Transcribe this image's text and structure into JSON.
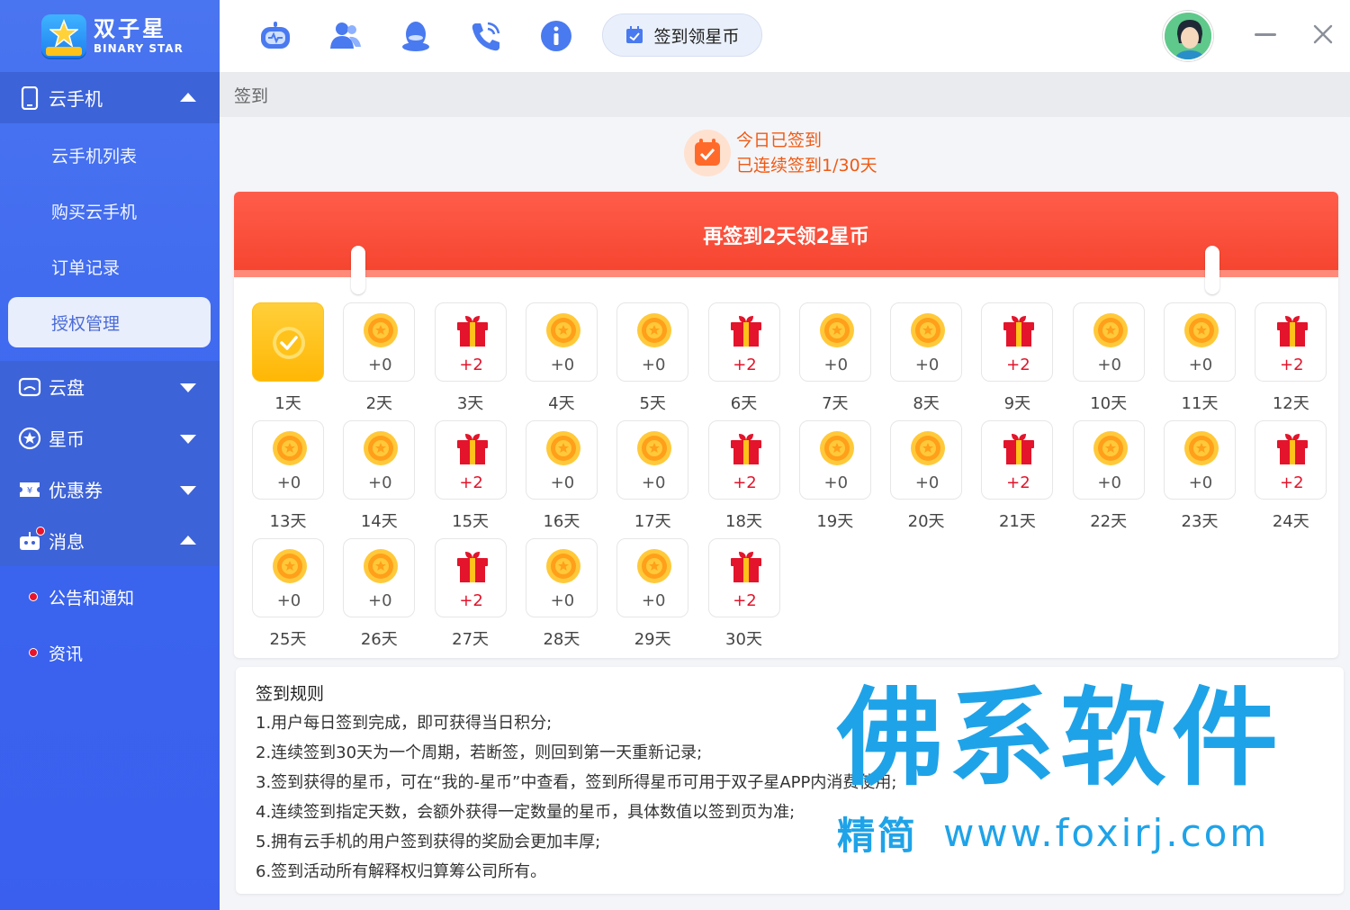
{
  "brand": {
    "name_cn": "双子星",
    "name_en": "BINARY STAR",
    "tag": "双子星"
  },
  "sidebar": {
    "cloud_phone": {
      "label": "云手机",
      "expanded": true,
      "items": [
        "云手机列表",
        "购买云手机",
        "订单记录",
        "授权管理"
      ],
      "active": "授权管理"
    },
    "cloud_disk": {
      "label": "云盘",
      "expanded": false
    },
    "star_coin": {
      "label": "星币",
      "expanded": false
    },
    "coupon": {
      "label": "优惠券",
      "expanded": false
    },
    "messages": {
      "label": "消息",
      "expanded": true,
      "items": [
        "公告和通知",
        "资讯"
      ]
    }
  },
  "topbar": {
    "icons": [
      "robot-icon",
      "users-icon",
      "qq-penguin-icon",
      "phone-icon",
      "info-icon"
    ],
    "checkin_button": "签到领星币"
  },
  "breadcrumb": "签到",
  "today": {
    "status": "今日已签到",
    "streak": "已连续签到1/30天"
  },
  "banner": "再签到2天领2星币",
  "days": [
    {
      "label": "1天",
      "type": "done",
      "pts": ""
    },
    {
      "label": "2天",
      "type": "coin",
      "pts": "+0"
    },
    {
      "label": "3天",
      "type": "gift",
      "pts": "+2"
    },
    {
      "label": "4天",
      "type": "coin",
      "pts": "+0"
    },
    {
      "label": "5天",
      "type": "coin",
      "pts": "+0"
    },
    {
      "label": "6天",
      "type": "gift",
      "pts": "+2"
    },
    {
      "label": "7天",
      "type": "coin",
      "pts": "+0"
    },
    {
      "label": "8天",
      "type": "coin",
      "pts": "+0"
    },
    {
      "label": "9天",
      "type": "gift",
      "pts": "+2"
    },
    {
      "label": "10天",
      "type": "coin",
      "pts": "+0"
    },
    {
      "label": "11天",
      "type": "coin",
      "pts": "+0"
    },
    {
      "label": "12天",
      "type": "gift",
      "pts": "+2"
    },
    {
      "label": "13天",
      "type": "coin",
      "pts": "+0"
    },
    {
      "label": "14天",
      "type": "coin",
      "pts": "+0"
    },
    {
      "label": "15天",
      "type": "gift",
      "pts": "+2"
    },
    {
      "label": "16天",
      "type": "coin",
      "pts": "+0"
    },
    {
      "label": "17天",
      "type": "coin",
      "pts": "+0"
    },
    {
      "label": "18天",
      "type": "gift",
      "pts": "+2"
    },
    {
      "label": "19天",
      "type": "coin",
      "pts": "+0"
    },
    {
      "label": "20天",
      "type": "coin",
      "pts": "+0"
    },
    {
      "label": "21天",
      "type": "gift",
      "pts": "+2"
    },
    {
      "label": "22天",
      "type": "coin",
      "pts": "+0"
    },
    {
      "label": "23天",
      "type": "coin",
      "pts": "+0"
    },
    {
      "label": "24天",
      "type": "gift",
      "pts": "+2"
    },
    {
      "label": "25天",
      "type": "coin",
      "pts": "+0"
    },
    {
      "label": "26天",
      "type": "coin",
      "pts": "+0"
    },
    {
      "label": "27天",
      "type": "gift",
      "pts": "+2"
    },
    {
      "label": "28天",
      "type": "coin",
      "pts": "+0"
    },
    {
      "label": "29天",
      "type": "coin",
      "pts": "+0"
    },
    {
      "label": "30天",
      "type": "gift",
      "pts": "+2"
    }
  ],
  "rules": {
    "title": "签到规则",
    "lines": [
      "1.用户每日签到完成，即可获得当日积分;",
      "2.连续签到30天为一个周期，若断签，则回到第一天重新记录;",
      "3.签到获得的星币，可在“我的-星币”中查看，签到所得星币可用于双子星APP内消费使用;",
      "4.连续签到指定天数，会额外获得一定数量的星币，具体数值以签到页为准;",
      "5.拥有云手机的用户签到获得的奖励会更加丰厚;",
      "6.签到活动所有解释权归算筹公司所有。"
    ]
  },
  "watermark": {
    "big": "佛系软件",
    "small1": "精简",
    "small2": "www.foxirj.com"
  },
  "colors": {
    "sidebar": "#3a64ee",
    "accent_red": "#f5432e",
    "coin": "#ffa61a",
    "text_red": "#e3142b",
    "watermark": "#1fa3e8"
  }
}
